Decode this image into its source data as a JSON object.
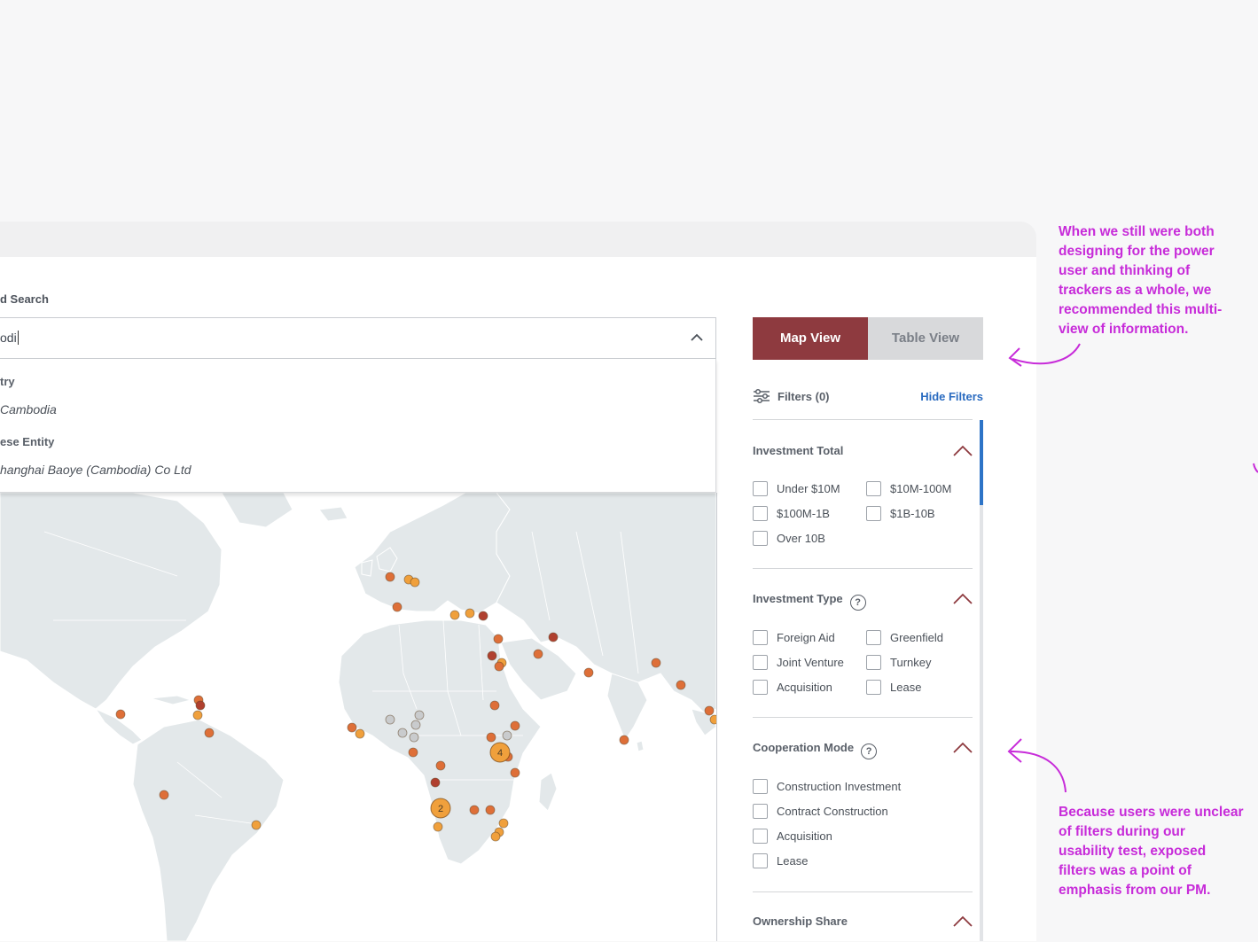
{
  "search": {
    "label": "d Search",
    "value": "odi"
  },
  "dropdown": {
    "groups": [
      {
        "heading": "try",
        "item": "Cambodia"
      },
      {
        "heading": "ese Entity",
        "item": "hanghai Baoye (Cambodia) Co Ltd"
      }
    ]
  },
  "view_toggle": {
    "map_label": "Map View",
    "table_label": "Table View",
    "active": "Map View"
  },
  "filters": {
    "label": "Filters (0)",
    "hide_label": "Hide Filters",
    "sections": {
      "investment_total": {
        "title": "Investment Total",
        "options": [
          "Under $10M",
          "$10M-100M",
          "$100M-1B",
          "$1B-10B",
          "Over 10B"
        ]
      },
      "investment_type": {
        "title": "Investment Type",
        "options": [
          "Foreign Aid",
          "Greenfield",
          "Joint Venture",
          "Turnkey",
          "Acquisition",
          "Lease"
        ]
      },
      "cooperation_mode": {
        "title": "Cooperation Mode",
        "options": [
          "Construction Investment",
          "Contract Construction",
          "Acquisition",
          "Lease"
        ]
      },
      "ownership_share": {
        "title": "Ownership Share"
      }
    }
  },
  "map": {
    "cluster_counts": [
      "4",
      "2"
    ],
    "colors": {
      "land": "#e3e8ea",
      "border": "#ffffff",
      "dark_red": "#b0402f",
      "orange": "#de6f38",
      "light_orange": "#f0a03c",
      "gray": "#c9cbcd"
    }
  },
  "annotations": {
    "top": "When we still were both designing for the power user and thinking of trackers as a whole, we recommended this multi-view of information.",
    "bottom": "Because users were unclear of filters during our usability test, exposed filters was a point of emphasis from our PM."
  },
  "colors": {
    "accent": "#8e3a3f",
    "link": "#2a6bc0",
    "annotation": "#c72bd9"
  }
}
